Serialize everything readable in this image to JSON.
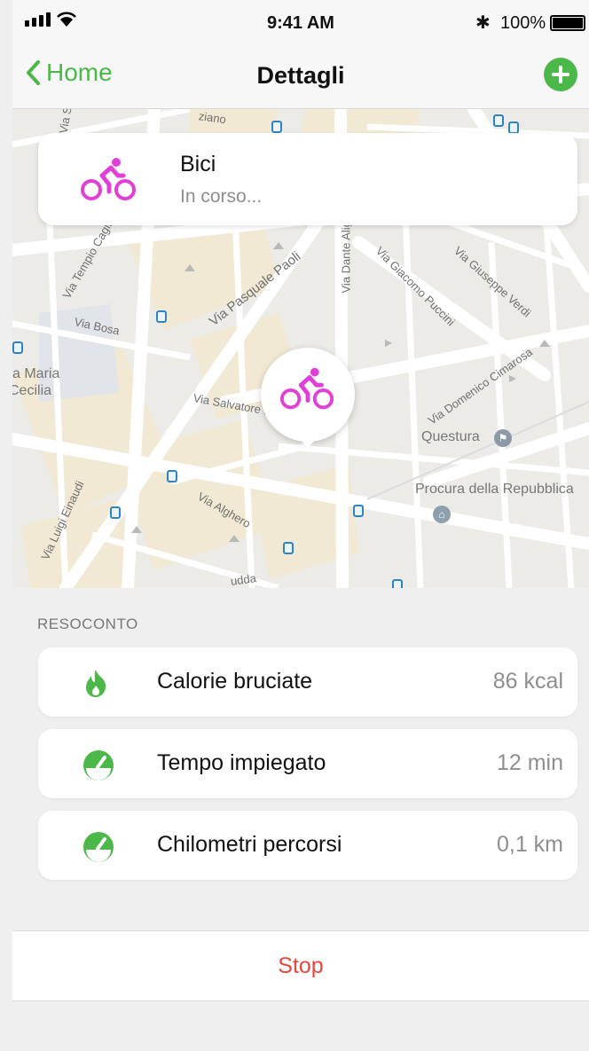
{
  "status_bar": {
    "time": "9:41 AM",
    "battery_percent": "100%",
    "bluetooth": "✱"
  },
  "nav": {
    "back_label": "Home",
    "title": "Dettagli",
    "add_icon": "plus-circle-icon"
  },
  "colors": {
    "accent": "#4cb849",
    "activity": "#e040d8",
    "stop": "#e8463b"
  },
  "activity": {
    "icon": "bike-icon",
    "name": "Bici",
    "status": "In corso..."
  },
  "map": {
    "streets": [
      "Via Tempio Caglio",
      "Via Bosa",
      "Via Pasquale Paoli",
      "Via Dante Alighieri",
      "Via Giacomo Puccini",
      "Via Giuseppe Verdi",
      "Via Salvatore Fa",
      "Via Domenico Cimarosa",
      "Via Alghero",
      "Via Luigi Einaudi",
      "Via S",
      "ziano",
      "Via",
      "udda"
    ],
    "places": [
      "a Maria",
      "Cecilia",
      "Questura",
      "Procura della Repubblica"
    ]
  },
  "summary": {
    "title": "RESOCONTO",
    "items": [
      {
        "icon": "flame-icon",
        "label": "Calorie bruciate",
        "value": "86 kcal"
      },
      {
        "icon": "gauge-icon",
        "label": "Tempo impiegato",
        "value": "12 min"
      },
      {
        "icon": "gauge-icon",
        "label": "Chilometri percorsi",
        "value": "0,1 km"
      }
    ]
  },
  "stop_label": "Stop"
}
